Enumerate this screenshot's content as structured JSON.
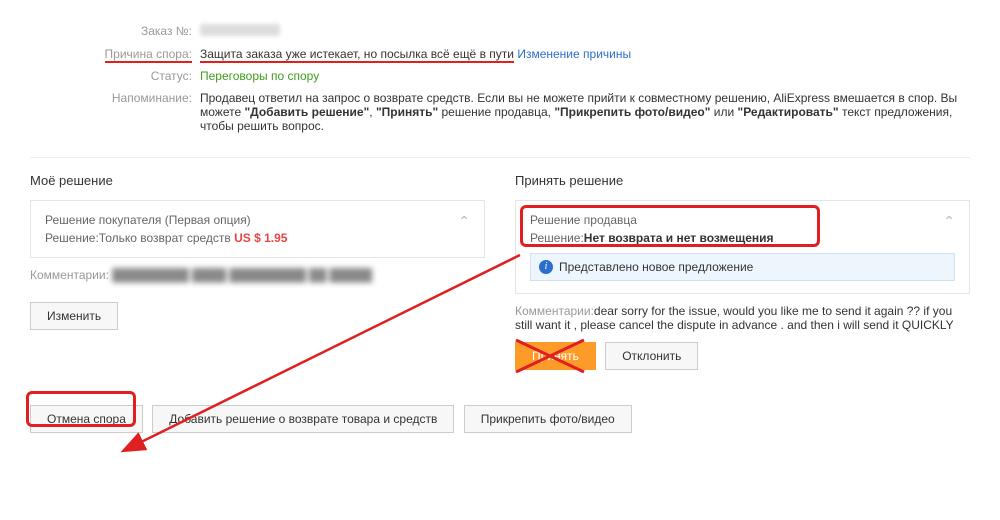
{
  "info": {
    "order_label": "Заказ №:",
    "reason_label": "Причина спора:",
    "reason_value": "Защита заказа уже истекает, но посылка всё ещё в пути",
    "change_reason": "Изменение причины",
    "status_label": "Статус:",
    "status_value": "Переговоры по спору",
    "reminder_label": "Напоминание:",
    "reminder_prefix": "Продавец ответил на запрос о возврате средств. Если вы не можете прийти к совместному решению, AliExpress вмешается в спор. Вы можете ",
    "reminder_add": "\"Добавить решение\"",
    "reminder_sep1": ", ",
    "reminder_accept": "\"Принять\"",
    "reminder_mid": " решение продавца, ",
    "reminder_attach": "\"Прикрепить фото/видео\"",
    "reminder_or": " или ",
    "reminder_edit": "\"Редактировать\"",
    "reminder_suffix": " текст предложения, чтобы решить вопрос."
  },
  "my": {
    "title": "Моё решение",
    "card_title": "Решение покупателя (Первая опция)",
    "decision_label": "Решение:",
    "decision_text": "Только возврат средств ",
    "decision_price": "US $ 1.95",
    "comments_label": "Комментарии:",
    "edit_btn": "Изменить"
  },
  "seller": {
    "title": "Принять решение",
    "card_title": "Решение продавца",
    "decision_label": "Решение:",
    "decision_text": "Нет возврата и нет возмещения",
    "banner": "Представлено новое предложение",
    "comments_label": "Комментарии:",
    "comments_body": "dear sorry for the issue, would you like me to send it again ?? if you still want it , please cancel the dispute in advance . and then i will send it QUICKLY",
    "accept_btn": "Принять",
    "reject_btn": "Отклонить"
  },
  "actions": {
    "cancel": "Отмена спора",
    "add": "Добавить решение о возврате товара и средств",
    "attach": "Прикрепить фото/видео"
  }
}
